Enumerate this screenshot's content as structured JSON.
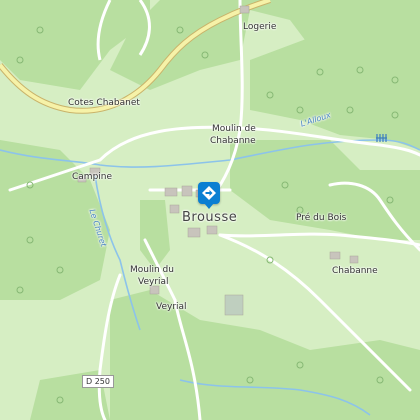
{
  "places": {
    "logerie": "Logerie",
    "cotes_chabanet": "Cotes Chabanet",
    "moulin_chabanne_1": "Moulin de",
    "moulin_chabanne_2": "Chabanne",
    "campine": "Campine",
    "brousse": "Brousse",
    "pre_du_bois": "Pré du Bois",
    "chabanne": "Chabanne",
    "moulin_veyrial_1": "Moulin du",
    "moulin_veyrial_2": "Veyrial",
    "veyrial": "Veyrial"
  },
  "rivers": {
    "alloux": "L'Alloux",
    "churet": "Le Churet"
  },
  "roads": {
    "d250": "D 250"
  },
  "marker": {
    "icon": "diamond-direction-icon",
    "color": "#0a7fd2"
  },
  "colors": {
    "forest": "#b8dfa0",
    "meadow": "#d6eec3",
    "main_road": "#f6f2a8",
    "water": "#8cc3ea"
  }
}
